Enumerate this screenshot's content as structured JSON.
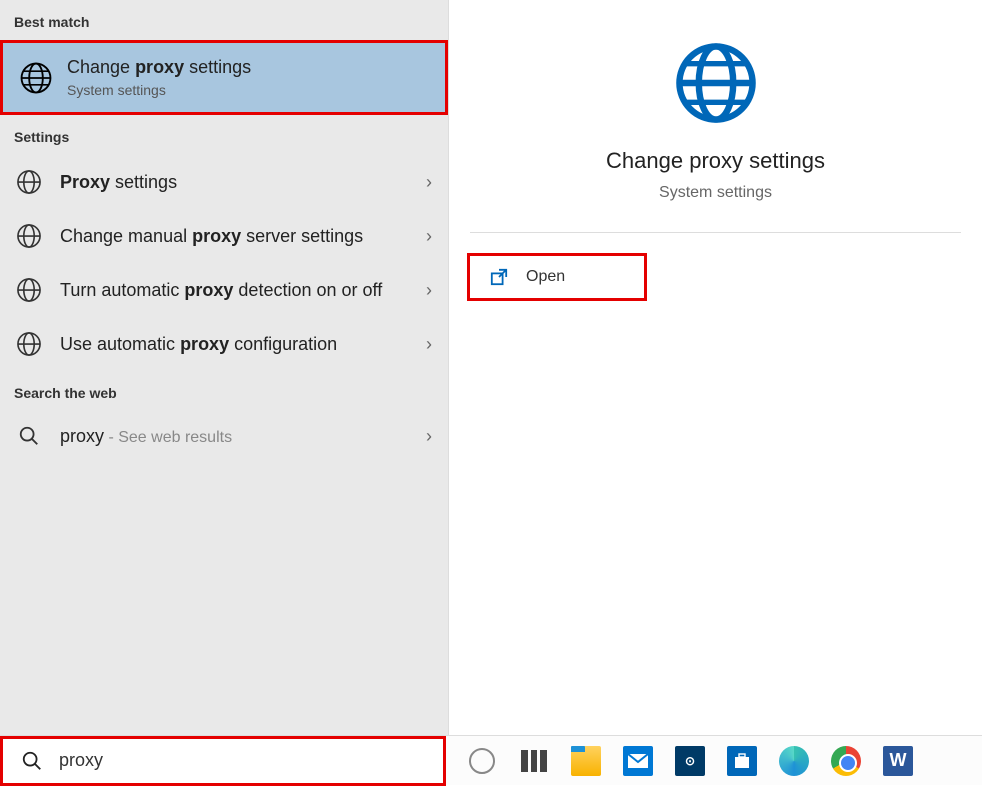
{
  "sections": {
    "best_match": "Best match",
    "settings": "Settings",
    "web": "Search the web"
  },
  "best_match_item": {
    "title_pre": "Change ",
    "title_bold": "proxy",
    "title_post": " settings",
    "subtitle": "System settings"
  },
  "settings_items": [
    {
      "pre": "",
      "bold": "Proxy",
      "post": " settings"
    },
    {
      "pre": "Change manual ",
      "bold": "proxy",
      "post": " server settings"
    },
    {
      "pre": "Turn automatic ",
      "bold": "proxy",
      "post": " detection on or off"
    },
    {
      "pre": "Use automatic ",
      "bold": "proxy",
      "post": " configuration"
    }
  ],
  "web_item": {
    "term": "proxy",
    "hint": " - See web results"
  },
  "detail": {
    "title": "Change proxy settings",
    "subtitle": "System settings",
    "open": "Open"
  },
  "search": {
    "value": "proxy"
  },
  "taskbar": {
    "apps": [
      "cortana",
      "taskview",
      "explorer",
      "mail",
      "dell",
      "store",
      "edge",
      "chrome",
      "word"
    ]
  }
}
